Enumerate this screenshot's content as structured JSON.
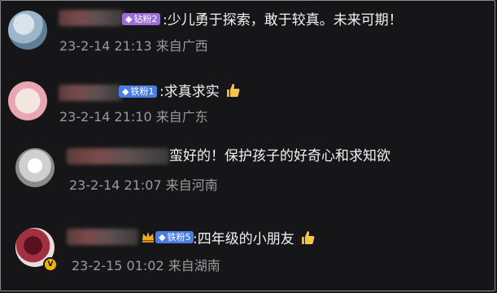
{
  "comments": [
    {
      "badge": "钻粉2",
      "text": ":少儿勇于探索，敢于较真。未来可期！",
      "time": "23-2-14 21:13",
      "location": "来自广西",
      "has_thumb": false
    },
    {
      "badge": "铁粉1",
      "text": ":求真求实",
      "time": "23-2-14 21:10",
      "location": "来自广东",
      "has_thumb": true
    },
    {
      "badge": "",
      "text": "蛮好的！保护孩子的好奇心和求知欲",
      "time": "23-2-14 21:07",
      "location": "来自河南",
      "has_thumb": false
    },
    {
      "badge": "铁粉5",
      "text": ":四年级的小朋友",
      "time": "23-2-15 01:02",
      "location": "来自湖南",
      "has_thumb": true
    }
  ],
  "colors": {
    "background": "#161618",
    "badge_purple": "#9b6cd6",
    "badge_blue": "#4a7de0",
    "meta_gray": "#9a9a9a"
  },
  "icons": [
    "thumbs-up-icon",
    "verified-icon",
    "crown-icon",
    "gem-icon"
  ]
}
